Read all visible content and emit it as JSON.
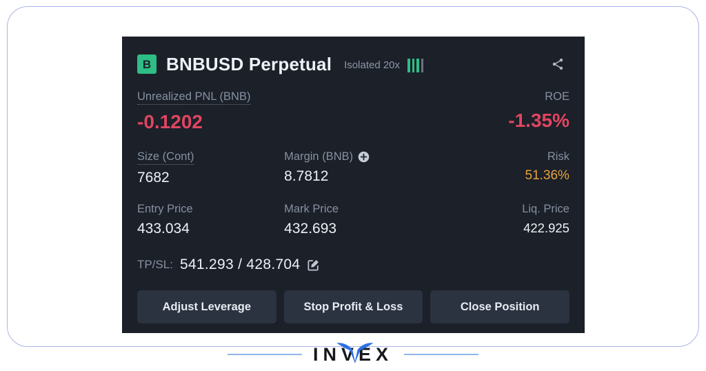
{
  "card": {
    "header": {
      "badge_letter": "B",
      "symbol": "BNBUSD Perpetual",
      "leverage": "Isolated 20x",
      "risk_bars_total": 4,
      "risk_bars_active": 3,
      "share_icon": "share-icon"
    },
    "pnl": {
      "label": "Unrealized PNL (BNB)",
      "value": "-0.1202",
      "roe_label": "ROE",
      "roe_value": "-1.35%"
    },
    "size_row": {
      "size_label": "Size (Cont)",
      "size_value": "7682",
      "margin_label": "Margin (BNB)",
      "margin_add_icon": "plus-circle-icon",
      "margin_value": "8.7812",
      "risk_label": "Risk",
      "risk_value": "51.36%"
    },
    "price_row": {
      "entry_label": "Entry Price",
      "entry_value": "433.034",
      "mark_label": "Mark Price",
      "mark_value": "432.693",
      "liq_label": "Liq. Price",
      "liq_value": "422.925"
    },
    "tpsl": {
      "label": "TP/SL:",
      "value": "541.293 / 428.704",
      "edit_icon": "edit-pencil-icon"
    },
    "buttons": {
      "adjust_leverage": "Adjust Leverage",
      "stop_profit_loss": "Stop Profit & Loss",
      "close_position": "Close Position"
    }
  },
  "footer": {
    "brand": "INVEX"
  },
  "colors": {
    "card_bg": "#1b2029",
    "accent_green": "#2ebd85",
    "negative_red": "#e04560",
    "warning_amber": "#e8a33d",
    "button_bg": "#2b3340",
    "frame_border": "#aab4e8",
    "logo_blue": "#2f6fe4"
  }
}
